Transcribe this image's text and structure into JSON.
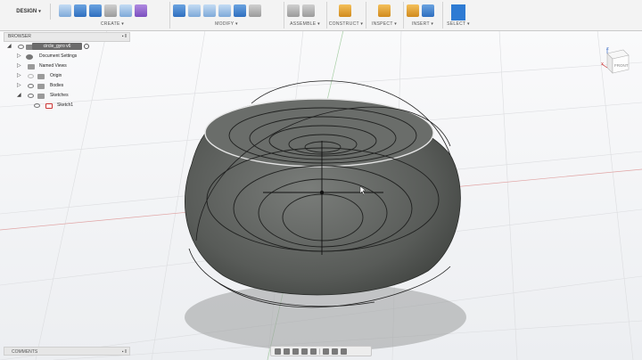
{
  "toolbar": {
    "workspace": "DESIGN",
    "groups": {
      "create": "CREATE ▾",
      "modify": "MODIFY ▾",
      "assemble": "ASSEMBLE ▾",
      "construct": "CONSTRUCT ▾",
      "inspect": "INSPECT ▾",
      "insert": "INSERT ▾",
      "select": "SELECT ▾"
    }
  },
  "browser": {
    "title": "BROWSER",
    "items": [
      {
        "label": "circle_gyro v6"
      },
      {
        "label": "Document Settings"
      },
      {
        "label": "Named Views"
      },
      {
        "label": "Origin"
      },
      {
        "label": "Bodies"
      },
      {
        "label": "Sketches"
      },
      {
        "label": "Sketch1"
      }
    ]
  },
  "comments": {
    "title": "COMMENTS"
  },
  "viewcube": {
    "front": "FRONT",
    "axis_z": "Z",
    "axis_x": "X"
  },
  "colors": {
    "accent": "#2e7bd3",
    "body": "#5f625f",
    "toolbar_bg": "#f3f3f3"
  }
}
